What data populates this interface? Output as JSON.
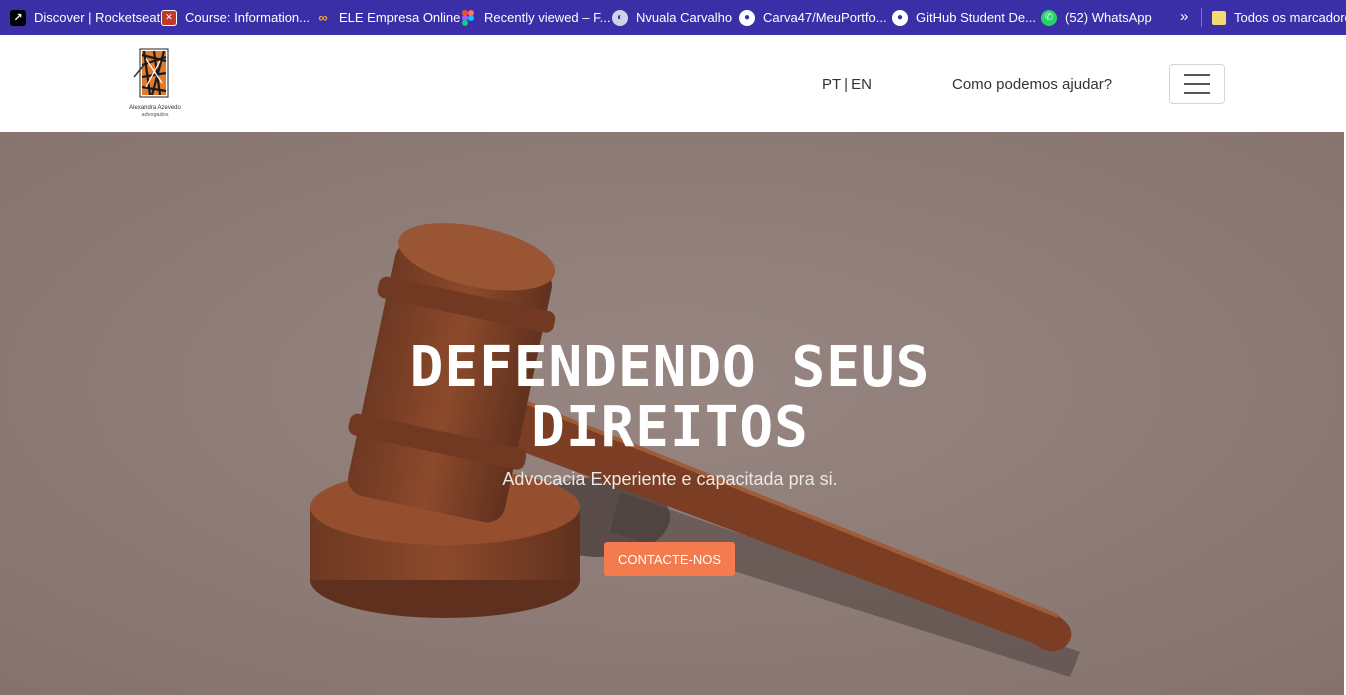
{
  "bookmarks": {
    "items": [
      {
        "label": "Discover | Rocketseat",
        "icon": "rocketseat-icon"
      },
      {
        "label": "Course: Information...",
        "icon": "flag-icon"
      },
      {
        "label": "ELE Empresa Online",
        "icon": "ele-icon"
      },
      {
        "label": "Recently viewed – F...",
        "icon": "figma-icon"
      },
      {
        "label": "Nvuala Carvalho",
        "icon": "globe-icon"
      },
      {
        "label": "Carva47/MeuPortfo...",
        "icon": "github-icon"
      },
      {
        "label": "GitHub Student De...",
        "icon": "github-icon"
      },
      {
        "label": "(52) WhatsApp",
        "icon": "whatsapp-icon"
      }
    ],
    "more_label": "»",
    "all_bookmarks_label": "Todos os marcadores"
  },
  "header": {
    "logo_text_line1": "Alexandra Azevedo",
    "logo_text_line2": "advogados",
    "lang_pt": "PT",
    "lang_sep": "|",
    "lang_en": "EN",
    "help_link": "Como podemos ajudar?"
  },
  "hero": {
    "title": "DEFENDENDO SEUS DIREITOS",
    "subtitle": "Advocacia Experiente e capacitada pra si.",
    "cta_label": "CONTACTE-NOS"
  },
  "colors": {
    "bookmarks_bg": "#3b2fa8",
    "hero_bg": "#8f7d78",
    "cta": "#f47b4d"
  }
}
